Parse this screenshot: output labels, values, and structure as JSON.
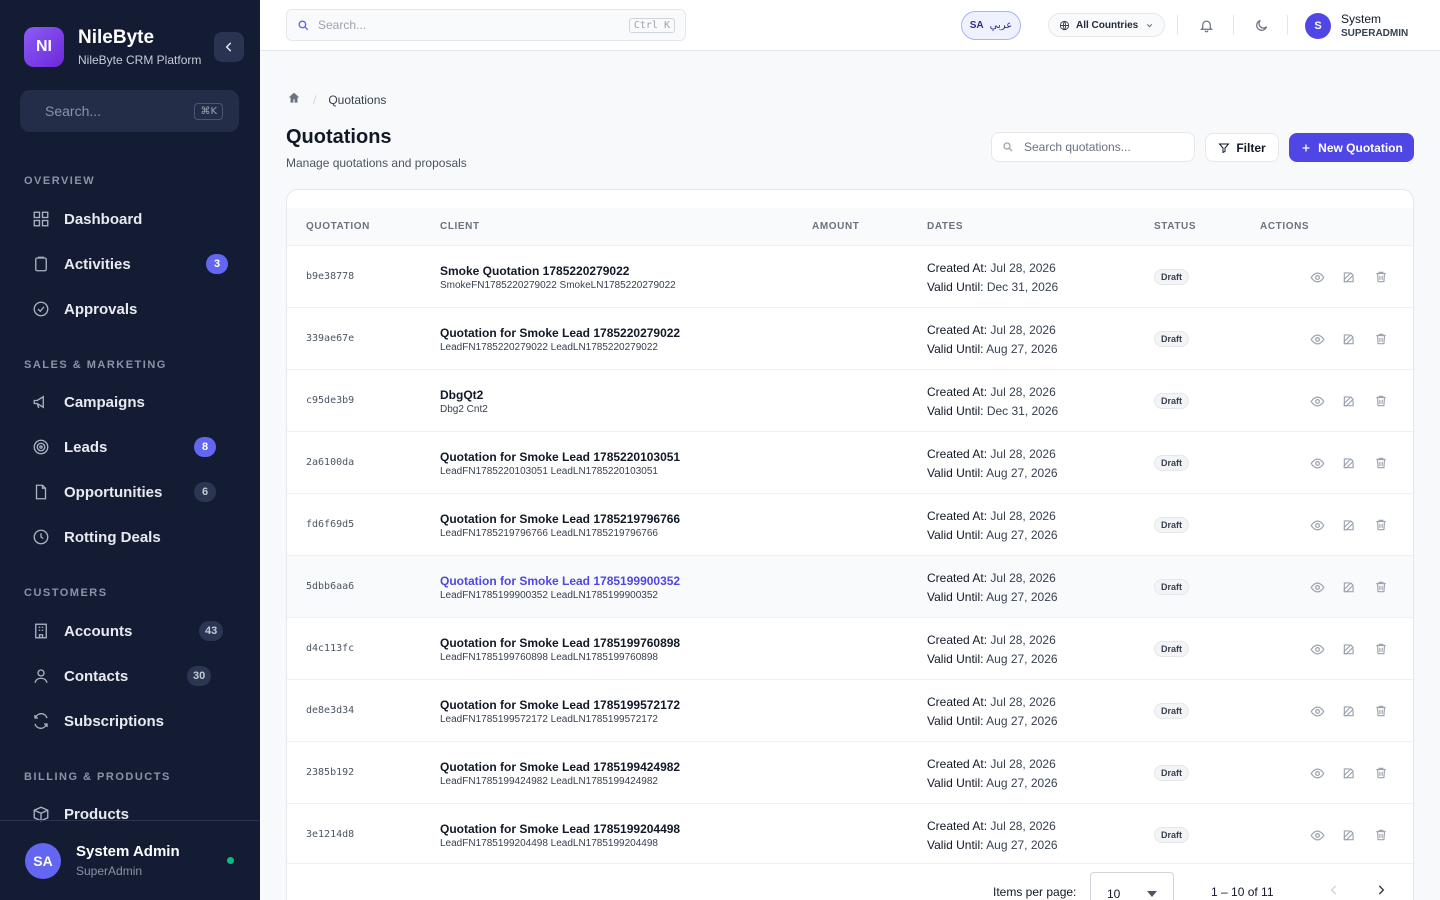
{
  "brand": {
    "logo": "NI",
    "name": "NileByte",
    "subtitle": "NileByte CRM Platform"
  },
  "sidebar": {
    "search_placeholder": "Search...",
    "search_shortcut": "⌘K",
    "sections": [
      {
        "label": "OVERVIEW"
      },
      {
        "label": "SALES & MARKETING"
      },
      {
        "label": "CUSTOMERS"
      },
      {
        "label": "BILLING & PRODUCTS"
      }
    ],
    "items": [
      {
        "label": "Dashboard",
        "icon": "grid-icon"
      },
      {
        "label": "Activities",
        "icon": "clipboard-icon",
        "badge": "3"
      },
      {
        "label": "Approvals",
        "icon": "check-circle-icon"
      },
      {
        "label": "Campaigns",
        "icon": "megaphone-icon"
      },
      {
        "label": "Leads",
        "icon": "target-icon",
        "badge": "8"
      },
      {
        "label": "Opportunities",
        "icon": "file-icon",
        "badge": "6"
      },
      {
        "label": "Rotting Deals",
        "icon": "clock-icon"
      },
      {
        "label": "Accounts",
        "icon": "building-icon",
        "badge": "43"
      },
      {
        "label": "Contacts",
        "icon": "user-icon",
        "badge": "30"
      },
      {
        "label": "Subscriptions",
        "icon": "refresh-icon"
      },
      {
        "label": "Products",
        "icon": "box-icon"
      }
    ],
    "user": {
      "initials": "SA",
      "name": "System Admin",
      "role": "SuperAdmin",
      "status_color": "#10b981"
    }
  },
  "topbar": {
    "search_placeholder": "Search...",
    "search_shortcut": "Ctrl K",
    "lang_code": "SA",
    "lang_label": "عربي",
    "country": "All Countries",
    "user": {
      "initials": "S",
      "name": "System",
      "role": "SUPERADMIN"
    }
  },
  "breadcrumb": {
    "current": "Quotations"
  },
  "page": {
    "title": "Quotations",
    "subtitle": "Manage quotations and proposals",
    "search_placeholder": "Search quotations...",
    "filter_label": "Filter",
    "new_label": "New Quotation"
  },
  "table": {
    "columns": [
      "QUOTATION",
      "CLIENT",
      "AMOUNT",
      "DATES",
      "STATUS",
      "ACTIONS"
    ],
    "created_label": "Created At:",
    "valid_label": "Valid Until:",
    "rows": [
      {
        "id": "b9e38778",
        "title": "Smoke Quotation 1785220279022",
        "client": "SmokeFN1785220279022 SmokeLN1785220279022",
        "created": "Jul 28, 2026",
        "valid": "Dec 31, 2026",
        "status": "Draft"
      },
      {
        "id": "339ae67e",
        "title": "Quotation for Smoke Lead 1785220279022",
        "client": "LeadFN1785220279022 LeadLN1785220279022",
        "created": "Jul 28, 2026",
        "valid": "Aug 27, 2026",
        "status": "Draft"
      },
      {
        "id": "c95de3b9",
        "title": "DbgQt2",
        "client": "Dbg2 Cnt2",
        "created": "Jul 28, 2026",
        "valid": "Dec 31, 2026",
        "status": "Draft"
      },
      {
        "id": "2a6100da",
        "title": "Quotation for Smoke Lead 1785220103051",
        "client": "LeadFN1785220103051 LeadLN1785220103051",
        "created": "Jul 28, 2026",
        "valid": "Aug 27, 2026",
        "status": "Draft"
      },
      {
        "id": "fd6f69d5",
        "title": "Quotation for Smoke Lead 1785219796766",
        "client": "LeadFN1785219796766 LeadLN1785219796766",
        "created": "Jul 28, 2026",
        "valid": "Aug 27, 2026",
        "status": "Draft"
      },
      {
        "id": "5dbb6aa6",
        "title": "Quotation for Smoke Lead 1785199900352",
        "client": "LeadFN1785199900352 LeadLN1785199900352",
        "created": "Jul 28, 2026",
        "valid": "Aug 27, 2026",
        "status": "Draft",
        "hover": true
      },
      {
        "id": "d4c113fc",
        "title": "Quotation for Smoke Lead 1785199760898",
        "client": "LeadFN1785199760898 LeadLN1785199760898",
        "created": "Jul 28, 2026",
        "valid": "Aug 27, 2026",
        "status": "Draft"
      },
      {
        "id": "de8e3d34",
        "title": "Quotation for Smoke Lead 1785199572172",
        "client": "LeadFN1785199572172 LeadLN1785199572172",
        "created": "Jul 28, 2026",
        "valid": "Aug 27, 2026",
        "status": "Draft"
      },
      {
        "id": "2385b192",
        "title": "Quotation for Smoke Lead 1785199424982",
        "client": "LeadFN1785199424982 LeadLN1785199424982",
        "created": "Jul 28, 2026",
        "valid": "Aug 27, 2026",
        "status": "Draft"
      },
      {
        "id": "3e1214d8",
        "title": "Quotation for Smoke Lead 1785199204498",
        "client": "LeadFN1785199204498 LeadLN1785199204498",
        "created": "Jul 28, 2026",
        "valid": "Aug 27, 2026",
        "status": "Draft"
      }
    ]
  },
  "pagination": {
    "items_per_page_label": "Items per page:",
    "items_per_page": "10",
    "range": "1 – 10 of 11"
  }
}
